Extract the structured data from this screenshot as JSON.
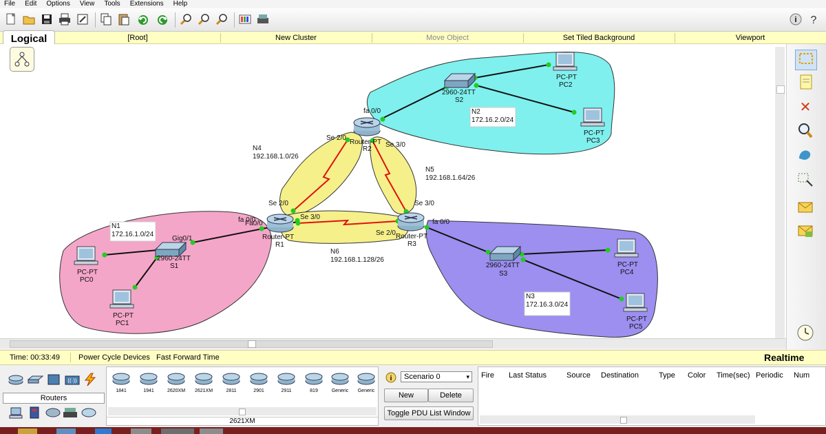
{
  "menu": [
    "File",
    "Edit",
    "Options",
    "View",
    "Tools",
    "Extensions",
    "Help"
  ],
  "toolbar": {
    "icons": [
      "new-file-icon",
      "open-folder-icon",
      "save-icon",
      "print-icon",
      "activity-wizard-icon",
      "copy-icon",
      "paste-icon",
      "undo-icon",
      "redo-icon",
      "zoom-in-icon",
      "zoom-reset-icon",
      "zoom-out-icon",
      "palette-icon",
      "custom-device-icon",
      "help-icon",
      "help-extra-icon"
    ]
  },
  "logical_bar": {
    "tab": "Logical",
    "root": "[Root]",
    "new_cluster": "New Cluster",
    "move_object": "Move Object",
    "set_tiled_background": "Set Tiled Background",
    "viewport": "Viewport"
  },
  "network": {
    "routers": [
      {
        "model": "Router-PT",
        "name": "R1"
      },
      {
        "model": "Router-PT",
        "name": "R2"
      },
      {
        "model": "Router-PT",
        "name": "R3"
      }
    ],
    "switches": [
      {
        "model": "2960-24TT",
        "name": "S1"
      },
      {
        "model": "2960-24TT",
        "name": "S2"
      },
      {
        "model": "2960-24TT",
        "name": "S3"
      }
    ],
    "pcs": [
      {
        "model": "PC-PT",
        "name": "PC0"
      },
      {
        "model": "PC-PT",
        "name": "PC1"
      },
      {
        "model": "PC-PT",
        "name": "PC2"
      },
      {
        "model": "PC-PT",
        "name": "PC3"
      },
      {
        "model": "PC-PT",
        "name": "PC4"
      },
      {
        "model": "PC-PT",
        "name": "PC5"
      }
    ],
    "networks": [
      {
        "name": "N1",
        "subnet": "172.16.1.0/24"
      },
      {
        "name": "N2",
        "subnet": "172.16.2.0/24"
      },
      {
        "name": "N3",
        "subnet": "172.16.3.0/24"
      },
      {
        "name": "N4",
        "subnet": "192.168.1.0/26"
      },
      {
        "name": "N5",
        "subnet": "192.168.1.64/26"
      },
      {
        "name": "N6",
        "subnet": "192.168.1.128/26"
      }
    ],
    "ports": {
      "r2_fa": "fa 0/0",
      "r2_se2": "Se 2/0",
      "r2_se3": "Se 3/0",
      "r1_se2": "Se 2/0",
      "r1_se3": "Se 3/0",
      "r1_fa_a": "fa 0/0",
      "r1_fa_b": "Fa0/0",
      "r3_se2": "Se 2/0",
      "r3_se3": "Se 3/0",
      "r3_fa": "fa 0/0",
      "s1_gig": "Gig0/1"
    },
    "colors": {
      "n1": "#f4a6c8",
      "n2": "#7ff0ee",
      "n3": "#9c8ff0",
      "wan": "#f6f08a",
      "serial": "#e01010",
      "link": "#111111",
      "port_dot": "#22cc22"
    }
  },
  "status": {
    "time_label": "Time: 00:33:49",
    "power_cycle": "Power Cycle Devices",
    "fast_forward": "Fast Forward Time",
    "mode": "Realtime"
  },
  "device_panel": {
    "category": "Routers",
    "models": [
      "1841",
      "1941",
      "2620XM",
      "2621XM",
      "2811",
      "2901",
      "2911",
      "819",
      "Generic",
      "Generic"
    ],
    "selected": "2621XM"
  },
  "scenario": {
    "selected": "Scenario 0",
    "new": "New",
    "delete": "Delete",
    "toggle": "Toggle PDU List Window"
  },
  "pdu_columns": [
    "Fire",
    "Last Status",
    "Source",
    "Destination",
    "Type",
    "Color",
    "Time(sec)",
    "Periodic",
    "Num"
  ]
}
